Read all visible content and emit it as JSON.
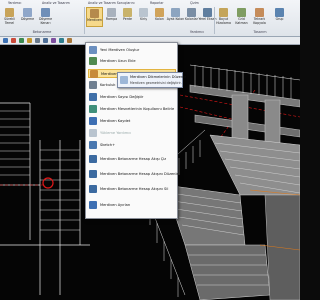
{
  "ribbon": {
    "tabs": [
      "Yardımcı",
      "Analiz ve Tasarım",
      "Analiz ve Tasarım Sonuçlarını",
      "Raporlar",
      "Çizim"
    ],
    "buttons": [
      {
        "label": "Sürekli Temel",
        "color": "#c8a45a"
      },
      {
        "label": "Döşeme",
        "color": "#8fa7c9"
      },
      {
        "label": "Döşeme Kenarı",
        "color": "#6f8fb8"
      },
      {
        "label": "Merdiven",
        "color": "#b58a4c"
      },
      {
        "label": "Rampa",
        "color": "#a9b2bd"
      },
      {
        "label": "Perde",
        "color": "#c9b36b"
      },
      {
        "label": "Kiriş",
        "color": "#b9c4cf"
      },
      {
        "label": "Kolon",
        "color": "#d0a35a"
      },
      {
        "label": "Ayak Kolon",
        "color": "#8da5c0"
      },
      {
        "label": "Kolonlar",
        "color": "#7a8ea5"
      },
      {
        "label": "Yerel Eksen",
        "color": "#5f7e9f"
      },
      {
        "label": "Boyut Hizalama",
        "color": "#c4a55a"
      },
      {
        "label": "Grid Katman",
        "color": "#7f9d62"
      },
      {
        "label": "Tekrarlı Kopyala",
        "color": "#c58c5a"
      },
      {
        "label": "Grup",
        "color": "#5b84b0"
      }
    ],
    "groups": [
      "Betonarme",
      "Yardımcı",
      "Tasarım"
    ]
  },
  "menu": {
    "items": [
      {
        "label": "Yeni Merdiven Oluştur",
        "color": "#6b8fbf",
        "highlighted": false,
        "disabled": false
      },
      {
        "label": "Merdiven Uzun Ekle",
        "color": "#4f8a4f",
        "highlighted": false,
        "disabled": false
      },
      {
        "label": "Merdiven Dikmelerinin Düzenle",
        "color": "#c78b3b",
        "highlighted": true,
        "disabled": false
      },
      {
        "label": "Korkuluk",
        "color": "#6f7f90",
        "highlighted": false,
        "disabled": false
      },
      {
        "label": "Merdiven Sayısı Değiştir",
        "color": "#3f6fa8",
        "highlighted": false,
        "disabled": false
      },
      {
        "label": "Merdiven Mesnetlerinin Koşullarını Belirle",
        "color": "#3f8f7a",
        "highlighted": false,
        "disabled": false
      },
      {
        "label": "Merdiven Kaydet",
        "color": "#3d6fb3",
        "highlighted": false,
        "disabled": false
      },
      {
        "label": "Yükleme Yardımcı",
        "color": "#b9c4cf",
        "highlighted": false,
        "disabled": true
      },
      {
        "label": "Sketch+",
        "color": "#4a78b0",
        "highlighted": false,
        "disabled": false
      },
      {
        "label": "Merdiven Betonarme Hesap Akışı Çiz",
        "color": "#3b6aa0",
        "highlighted": false,
        "disabled": false
      },
      {
        "label": "Merdiven Betonarme Hesap Akışını Düzenle",
        "color": "#3b6aa0",
        "highlighted": false,
        "disabled": false
      },
      {
        "label": "Merdiven Betonarme Hesap Akışını Sil",
        "color": "#3b6aa0",
        "highlighted": false,
        "disabled": false
      },
      {
        "label": "Merdiven Ayırları",
        "color": "#3d6fb3",
        "highlighted": false,
        "disabled": false
      }
    ]
  },
  "tooltip": {
    "title": "Merdiven Dikmelerinin Düzenle",
    "description": "Merdiven geometrisini değiştirir."
  },
  "colors": {
    "background": "#050505",
    "grid_line": "#ffffff",
    "axis_red": "#e01818",
    "stair_fill": "#8e8e8e",
    "selection_marker": "#e01818"
  }
}
